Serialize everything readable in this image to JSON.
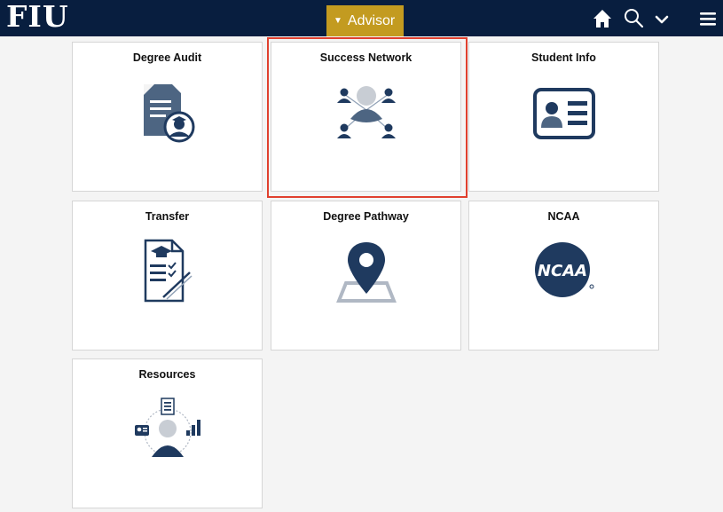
{
  "header": {
    "logo_text": "FIU",
    "role_menu_label": "Advisor",
    "icons": [
      "home-icon",
      "search-icon",
      "chevron-down-icon",
      "menu-icon"
    ]
  },
  "tiles": [
    {
      "title": "Degree Audit",
      "icon": "degree-audit-icon"
    },
    {
      "title": "Success Network",
      "icon": "success-network-icon"
    },
    {
      "title": "Student Info",
      "icon": "id-card-icon"
    },
    {
      "title": "Transfer",
      "icon": "transfer-document-icon"
    },
    {
      "title": "Degree Pathway",
      "icon": "map-pin-icon"
    },
    {
      "title": "NCAA",
      "icon": "ncaa-logo"
    },
    {
      "title": "Resources",
      "icon": "resources-icon"
    }
  ],
  "colors": {
    "header_bg": "#081e3f",
    "accent_gold": "#c39b20",
    "icon_navy": "#1f3a5f",
    "icon_gray": "#b0b8c4",
    "highlight_red": "#e0402e"
  }
}
